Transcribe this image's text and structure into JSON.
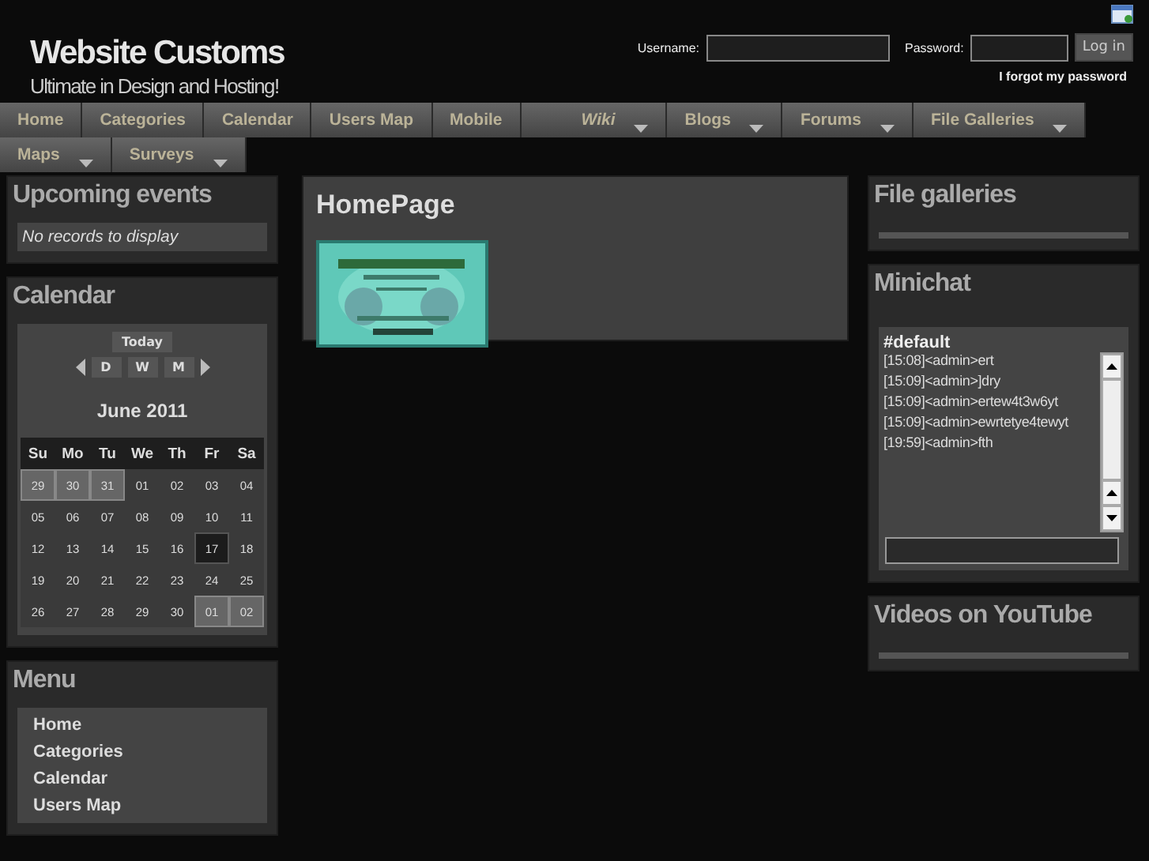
{
  "site": {
    "title": "Website Customs",
    "tagline": "Ultimate in Design and Hosting!"
  },
  "login": {
    "username_label": "Username:",
    "password_label": "Password:",
    "button": "Log in",
    "forgot": "I forgot my password"
  },
  "nav": [
    {
      "label": "Home",
      "has_menu": false,
      "selected": false
    },
    {
      "label": "Categories",
      "has_menu": false,
      "selected": false
    },
    {
      "label": "Calendar",
      "has_menu": false,
      "selected": false
    },
    {
      "label": "Users Map",
      "has_menu": false,
      "selected": false
    },
    {
      "label": "Mobile",
      "has_menu": false,
      "selected": false
    },
    {
      "label": "Wiki",
      "has_menu": true,
      "selected": true
    },
    {
      "label": "Blogs",
      "has_menu": true,
      "selected": false
    },
    {
      "label": "Forums",
      "has_menu": true,
      "selected": false
    },
    {
      "label": "File Galleries",
      "has_menu": true,
      "selected": false
    },
    {
      "label": "Maps",
      "has_menu": true,
      "selected": false
    },
    {
      "label": "Surveys",
      "has_menu": true,
      "selected": false
    }
  ],
  "upcoming_events": {
    "title": "Upcoming events",
    "empty": "No records to display"
  },
  "calendar": {
    "title": "Calendar",
    "today_button": "Today",
    "view_buttons": [
      "D",
      "W",
      "M"
    ],
    "month": "June 2011",
    "weekdays": [
      "Su",
      "Mo",
      "Tu",
      "We",
      "Th",
      "Fr",
      "Sa"
    ],
    "weeks": [
      [
        {
          "day": "29",
          "kind": "other"
        },
        {
          "day": "30",
          "kind": "other"
        },
        {
          "day": "31",
          "kind": "other"
        },
        {
          "day": "01",
          "kind": "day"
        },
        {
          "day": "02",
          "kind": "day"
        },
        {
          "day": "03",
          "kind": "day"
        },
        {
          "day": "04",
          "kind": "day"
        }
      ],
      [
        {
          "day": "05",
          "kind": "day"
        },
        {
          "day": "06",
          "kind": "day"
        },
        {
          "day": "07",
          "kind": "day"
        },
        {
          "day": "08",
          "kind": "day"
        },
        {
          "day": "09",
          "kind": "day"
        },
        {
          "day": "10",
          "kind": "day"
        },
        {
          "day": "11",
          "kind": "day"
        }
      ],
      [
        {
          "day": "12",
          "kind": "day"
        },
        {
          "day": "13",
          "kind": "day"
        },
        {
          "day": "14",
          "kind": "day"
        },
        {
          "day": "15",
          "kind": "day"
        },
        {
          "day": "16",
          "kind": "day"
        },
        {
          "day": "17",
          "kind": "today"
        },
        {
          "day": "18",
          "kind": "day"
        }
      ],
      [
        {
          "day": "19",
          "kind": "day"
        },
        {
          "day": "20",
          "kind": "day"
        },
        {
          "day": "21",
          "kind": "day"
        },
        {
          "day": "22",
          "kind": "day"
        },
        {
          "day": "23",
          "kind": "day"
        },
        {
          "day": "24",
          "kind": "day"
        },
        {
          "day": "25",
          "kind": "day"
        }
      ],
      [
        {
          "day": "26",
          "kind": "day"
        },
        {
          "day": "27",
          "kind": "day"
        },
        {
          "day": "28",
          "kind": "day"
        },
        {
          "day": "29",
          "kind": "day"
        },
        {
          "day": "30",
          "kind": "day"
        },
        {
          "day": "01",
          "kind": "other"
        },
        {
          "day": "02",
          "kind": "other"
        }
      ]
    ]
  },
  "menu": {
    "title": "Menu",
    "items": [
      "Home",
      "Categories",
      "Calendar",
      "Users Map"
    ]
  },
  "main": {
    "title": "HomePage"
  },
  "file_galleries": {
    "title": "File galleries"
  },
  "minichat": {
    "title": "Minichat",
    "channel": "#default",
    "messages": [
      "[15:08]<admin>ert",
      "[15:09]<admin>]dry",
      "[15:09]<admin>ertew4t3w6yt",
      "[15:09]<admin>ewrtetye4tewyt",
      "[19:59]<admin>fth"
    ]
  },
  "videos": {
    "title": "Videos on YouTube"
  }
}
